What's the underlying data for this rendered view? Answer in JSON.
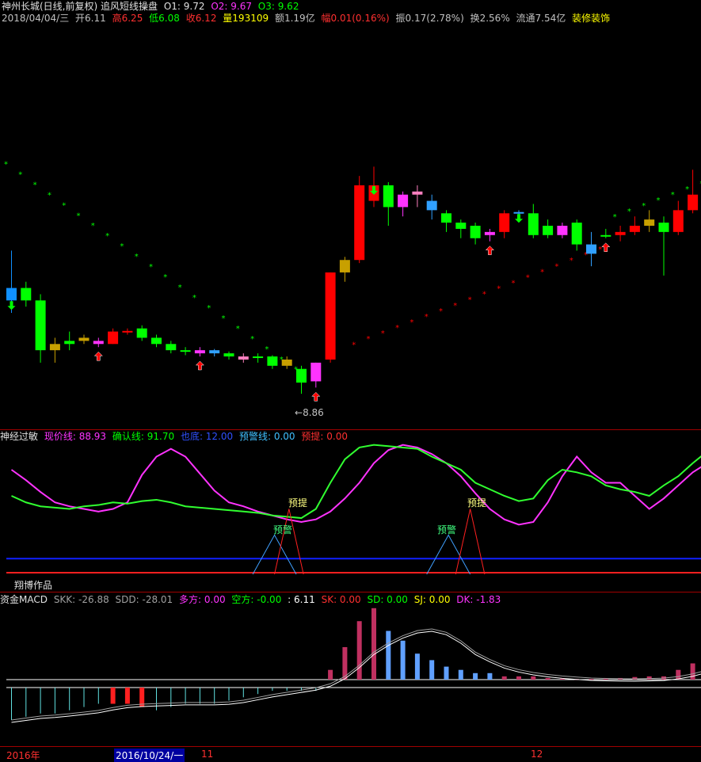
{
  "colors": {
    "bg": "#000000",
    "up": "#ff0000",
    "down": "#00ff00",
    "gold": "#c8a000",
    "magenta": "#ff33ff",
    "white": "#ffffff",
    "yellow": "#ffff00",
    "cyan": "#00ffff",
    "pink": "#ff80c0",
    "blue": "#1020ff",
    "sep": "#a00000"
  },
  "header": {
    "title": "神州长城(日线,前复权) 追风短线操盘",
    "o1_label": "O1: 9.72",
    "o2_label": "O2: 9.67",
    "o3_label": "O3: 9.62",
    "date": "2018/04/04/三",
    "open": "开6.11",
    "high": "高6.25",
    "low": "低6.08",
    "close": "收6.12",
    "volume": "量193109",
    "amount": "额1.19亿",
    "change": "幅0.01(0.16%)",
    "amplitude": "振0.17(2.78%)",
    "turnover": "换2.56%",
    "float": "流通7.54亿",
    "sector": "装修装饰"
  },
  "main_panel": {
    "low_marker": "8.86"
  },
  "indicator1": {
    "name": "神经过敏",
    "xianjia": "现价线: 88.93",
    "queren": "确认线: 91.70",
    "dibu": "也底: 12.00",
    "yujing": "预警线: 0.00",
    "yuti": "预提: 0.00",
    "signal_yuti": "预提",
    "signal_yujing": "预警",
    "author": "翔博作品"
  },
  "indicator2": {
    "name": "资金MACD",
    "skk": "SKK: -26.88",
    "sdd": "SDD: -28.01",
    "duofang": "多方: 0.00",
    "kongfang": "空方: -0.00",
    "val": ": 6.11",
    "sk": "SK: 0.00",
    "sd": "SD: 0.00",
    "sj": "SJ: 0.00",
    "dk": "DK: -1.83"
  },
  "time_axis": {
    "year": "2016年",
    "cursor_date": "2016/10/24/一",
    "m11": "11",
    "m12": "12"
  },
  "chart_data": {
    "type": "candlestick",
    "candles": [
      [
        8.4,
        8.6,
        9.2,
        8.2,
        "a"
      ],
      [
        8.6,
        8.4,
        8.7,
        8.3,
        "d"
      ],
      [
        8.4,
        7.6,
        8.5,
        7.4,
        "d"
      ],
      [
        7.7,
        7.6,
        7.8,
        7.4,
        "g"
      ],
      [
        7.7,
        7.75,
        7.9,
        7.6,
        "d"
      ],
      [
        7.75,
        7.8,
        7.85,
        7.7,
        "g"
      ],
      [
        7.75,
        7.7,
        7.8,
        7.65,
        "m"
      ],
      [
        7.7,
        7.9,
        7.95,
        7.7,
        "u"
      ],
      [
        7.9,
        7.91,
        7.95,
        7.85,
        "u"
      ],
      [
        7.95,
        7.8,
        8.0,
        7.75,
        "d"
      ],
      [
        7.8,
        7.7,
        7.85,
        7.65,
        "d"
      ],
      [
        7.7,
        7.6,
        7.75,
        7.55,
        "d"
      ],
      [
        7.6,
        7.58,
        7.65,
        7.52,
        "d"
      ],
      [
        7.6,
        7.55,
        7.65,
        7.5,
        "m"
      ],
      [
        7.6,
        7.55,
        7.62,
        7.5,
        "c"
      ],
      [
        7.55,
        7.5,
        7.58,
        7.45,
        "d"
      ],
      [
        7.5,
        7.45,
        7.55,
        7.4,
        "p"
      ],
      [
        7.5,
        7.48,
        7.55,
        7.4,
        "d"
      ],
      [
        7.5,
        7.35,
        7.52,
        7.3,
        "d"
      ],
      [
        7.45,
        7.35,
        7.5,
        7.3,
        "g"
      ],
      [
        7.3,
        7.08,
        7.35,
        6.9,
        "d"
      ],
      [
        7.1,
        7.4,
        7.4,
        7.0,
        "m"
      ],
      [
        7.45,
        8.85,
        8.85,
        7.4,
        "u"
      ],
      [
        8.85,
        9.05,
        9.1,
        8.7,
        "g"
      ],
      [
        9.05,
        10.25,
        10.4,
        9.0,
        "u"
      ],
      [
        10.25,
        10.0,
        10.55,
        9.9,
        "u"
      ],
      [
        10.25,
        9.9,
        10.3,
        9.6,
        "d"
      ],
      [
        9.9,
        10.1,
        10.15,
        9.75,
        "m"
      ],
      [
        10.1,
        10.15,
        10.25,
        9.9,
        "p"
      ],
      [
        10.0,
        9.85,
        10.1,
        9.7,
        "c"
      ],
      [
        9.8,
        9.65,
        9.85,
        9.5,
        "d"
      ],
      [
        9.65,
        9.55,
        9.7,
        9.4,
        "d"
      ],
      [
        9.6,
        9.4,
        9.65,
        9.3,
        "d"
      ],
      [
        9.45,
        9.5,
        9.55,
        9.35,
        "m"
      ],
      [
        9.5,
        9.8,
        9.85,
        9.4,
        "u"
      ],
      [
        9.8,
        9.82,
        9.85,
        9.72,
        "c"
      ],
      [
        9.8,
        9.45,
        9.95,
        9.4,
        "d"
      ],
      [
        9.45,
        9.6,
        9.7,
        9.4,
        "d"
      ],
      [
        9.6,
        9.45,
        9.65,
        9.4,
        "m"
      ],
      [
        9.65,
        9.3,
        9.7,
        9.2,
        "d"
      ],
      [
        9.3,
        9.15,
        9.5,
        8.95,
        "c"
      ],
      [
        9.45,
        9.45,
        9.55,
        9.4,
        "d"
      ],
      [
        9.45,
        9.5,
        9.6,
        9.35,
        "u"
      ],
      [
        9.5,
        9.6,
        9.75,
        9.45,
        "u"
      ],
      [
        9.6,
        9.7,
        9.85,
        9.5,
        "g"
      ],
      [
        9.65,
        9.5,
        9.75,
        8.8,
        "d"
      ],
      [
        9.5,
        9.85,
        10.0,
        9.45,
        "u"
      ],
      [
        9.85,
        10.1,
        10.5,
        9.8,
        "u"
      ],
      [
        10.1,
        10.25,
        10.5,
        10.0,
        "u"
      ]
    ],
    "indicator1": {
      "xianjia": [
        80,
        72,
        63,
        55,
        52,
        50,
        48,
        50,
        55,
        76,
        90,
        96,
        90,
        77,
        64,
        55,
        52,
        48,
        45,
        42,
        40,
        42,
        48,
        58,
        70,
        85,
        95,
        99,
        97,
        92,
        85,
        75,
        62,
        50,
        42,
        38,
        40,
        55,
        75,
        90,
        78,
        70,
        70,
        60,
        50,
        58,
        68,
        78,
        85
      ],
      "queren": [
        60,
        55,
        52,
        51,
        50,
        52,
        53,
        55,
        54,
        56,
        57,
        55,
        52,
        51,
        50,
        49,
        48,
        47,
        45,
        44,
        43,
        50,
        70,
        88,
        97,
        99,
        98,
        97,
        96,
        90,
        85,
        80,
        70,
        65,
        60,
        56,
        58,
        72,
        80,
        78,
        75,
        68,
        65,
        63,
        60,
        68,
        75,
        85,
        94
      ]
    },
    "indicator2": {
      "bars": [
        -10,
        -9,
        -8,
        -8,
        -7,
        -6,
        -5,
        -5,
        -5,
        -6,
        -7,
        -6,
        -5,
        -5,
        -5,
        -4,
        -3,
        -2,
        -1,
        -1,
        -1,
        -1,
        3,
        10,
        18,
        22,
        15,
        12,
        8,
        6,
        4,
        3,
        2,
        2,
        1,
        1,
        1,
        0.5,
        0.3,
        0.2,
        0.2,
        0.3,
        0.5,
        0.8,
        1,
        1,
        3,
        5,
        7
      ]
    }
  }
}
